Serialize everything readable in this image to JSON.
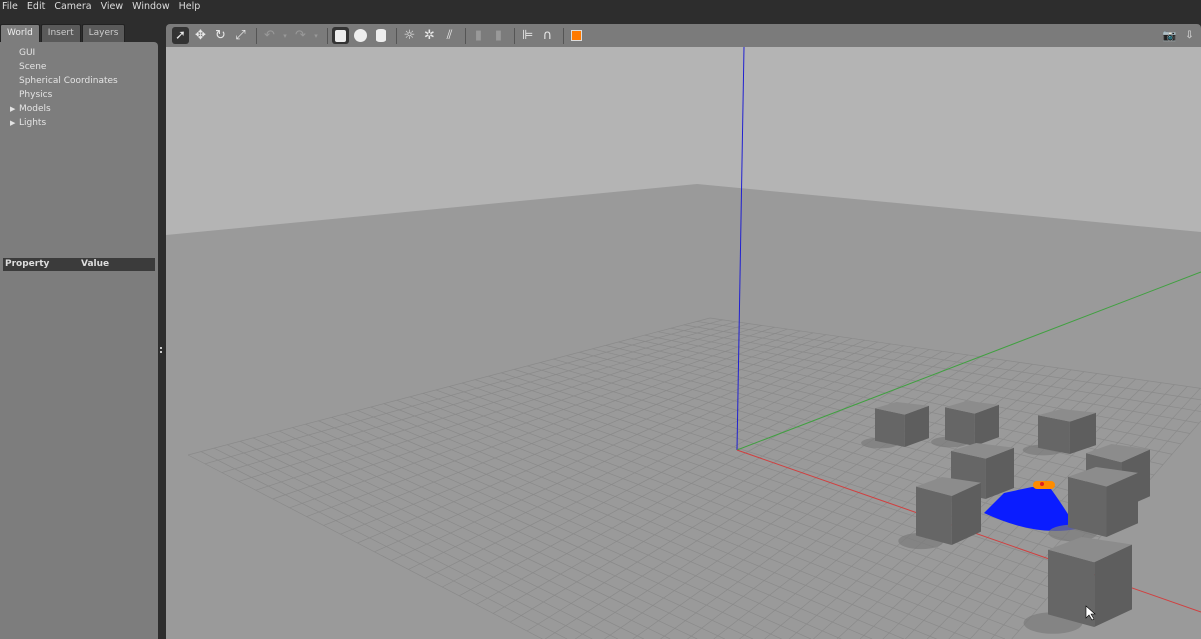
{
  "menu": [
    "File",
    "Edit",
    "Camera",
    "View",
    "Window",
    "Help"
  ],
  "tabs": [
    "World",
    "Insert",
    "Layers"
  ],
  "tree": [
    {
      "label": "GUI",
      "expandable": false
    },
    {
      "label": "Scene",
      "expandable": false
    },
    {
      "label": "Spherical Coordinates",
      "expandable": false
    },
    {
      "label": "Physics",
      "expandable": false
    },
    {
      "label": "Models",
      "expandable": true
    },
    {
      "label": "Lights",
      "expandable": true
    }
  ],
  "properties": {
    "col1": "Property",
    "col2": "Value"
  },
  "toolbar": {
    "tools": [
      "select-arrow-icon",
      "translate-icon",
      "rotate-icon",
      "scale-icon",
      "undo-icon",
      "redo-icon",
      "box-icon",
      "sphere-icon",
      "cylinder-icon",
      "point-light-icon",
      "spot-light-icon",
      "directional-light-icon",
      "copy-icon",
      "paste-icon",
      "align-icon",
      "snap-icon",
      "view-angle-icon"
    ],
    "right": [
      "screenshot-icon",
      "log-icon"
    ]
  },
  "colors": {
    "x_axis": "#d04040",
    "y_axis": "#40a040",
    "z_axis": "#2020d0",
    "robot": "#0a1cff",
    "accent": "#ff7a00"
  }
}
